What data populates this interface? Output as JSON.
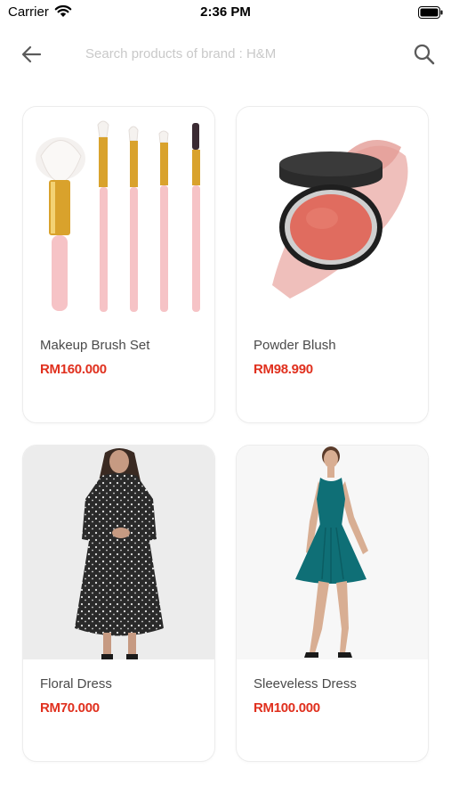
{
  "status_bar": {
    "carrier": "Carrier",
    "time": "2:36 PM"
  },
  "search": {
    "placeholder": "Search products of brand : H&M",
    "value": ""
  },
  "products": [
    {
      "name": "Makeup Brush Set",
      "price": "RM160.000",
      "image_icon": "makeup-brush-set-image"
    },
    {
      "name": "Powder Blush",
      "price": "RM98.990",
      "image_icon": "powder-blush-image"
    },
    {
      "name": "Floral Dress",
      "price": "RM70.000",
      "image_icon": "floral-dress-image"
    },
    {
      "name": "Sleeveless Dress",
      "price": "RM100.000",
      "image_icon": "sleeveless-dress-image"
    }
  ],
  "colors": {
    "price": "#e0301e",
    "card_border": "#ececec",
    "placeholder": "#c9c9c9"
  }
}
